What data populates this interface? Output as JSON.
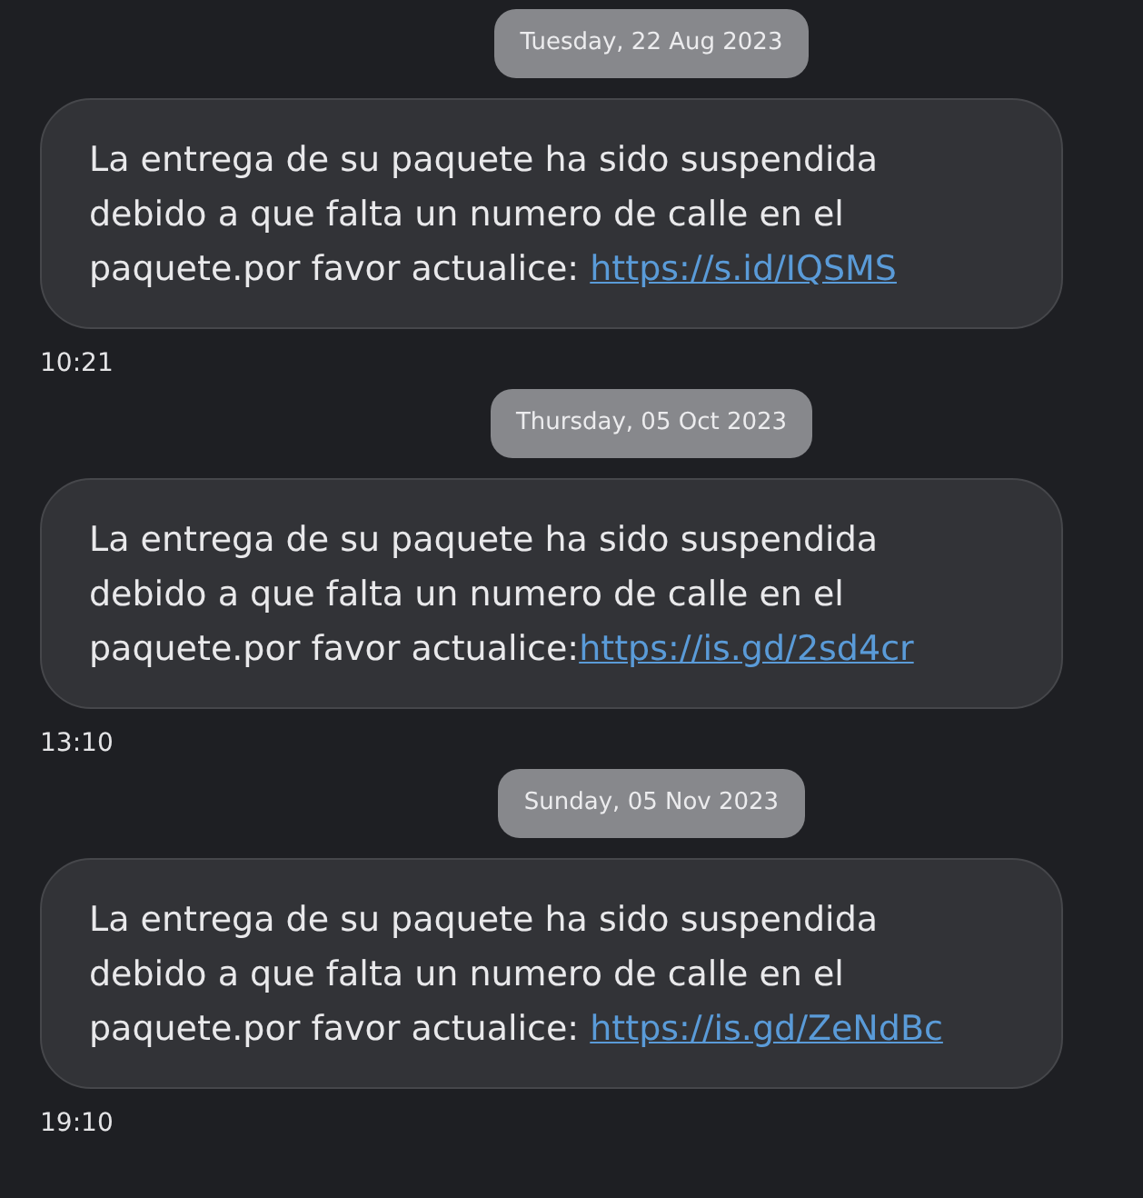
{
  "messages": [
    {
      "date": "Tuesday, 22 Aug 2023",
      "text": "La entrega de su paquete ha sido suspendida debido a que falta un numero de calle en el paquete.por favor actualice: ",
      "link": "https://s.id/IQSMS",
      "time": "10:21"
    },
    {
      "date": "Thursday, 05 Oct 2023",
      "text": "La entrega de su paquete ha sido suspendida debido a que falta un numero de calle en el paquete.por favor actualice:",
      "link": "https://is.gd/2sd4cr",
      "time": "13:10"
    },
    {
      "date": "Sunday, 05 Nov 2023",
      "text": "La entrega de su paquete ha sido suspendida debido a que falta un numero de calle en el paquete.por favor actualice: ",
      "link": "https://is.gd/ZeNdBc",
      "time": "19:10"
    }
  ]
}
